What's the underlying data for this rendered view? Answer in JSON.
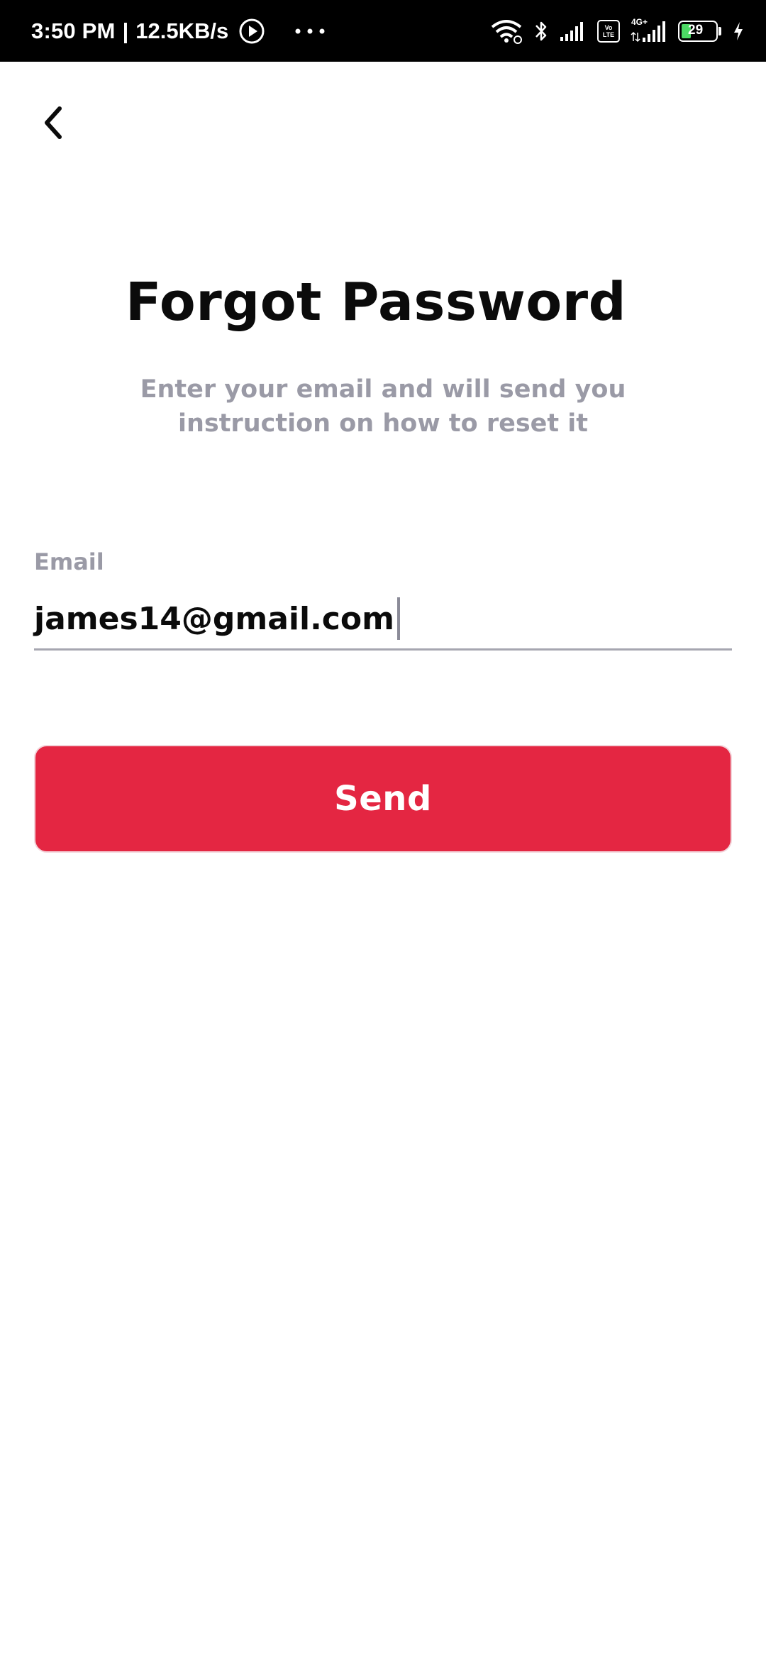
{
  "status_bar": {
    "time": "3:50 PM",
    "separator": "|",
    "network_speed": "12.5KB/s",
    "volte_label": "Vo LTE",
    "network_type": "4G+",
    "battery_level": "29",
    "icons": [
      "play-icon",
      "more-dots-icon",
      "wifi-icon",
      "bluetooth-icon",
      "signal-icon",
      "volte-icon",
      "signal-4g-icon",
      "battery-icon",
      "charging-icon"
    ]
  },
  "header": {
    "back_icon": "chevron-left-icon"
  },
  "main": {
    "title": "Forgot Password",
    "subtitle": "Enter your email and will send you instruction on how to reset it"
  },
  "form": {
    "email_label": "Email",
    "email_value": "james14@gmail.com",
    "send_label": "Send"
  },
  "colors": {
    "accent": "#e42642",
    "muted_text": "#9a9aa6",
    "title_text": "#0b0b0b"
  }
}
